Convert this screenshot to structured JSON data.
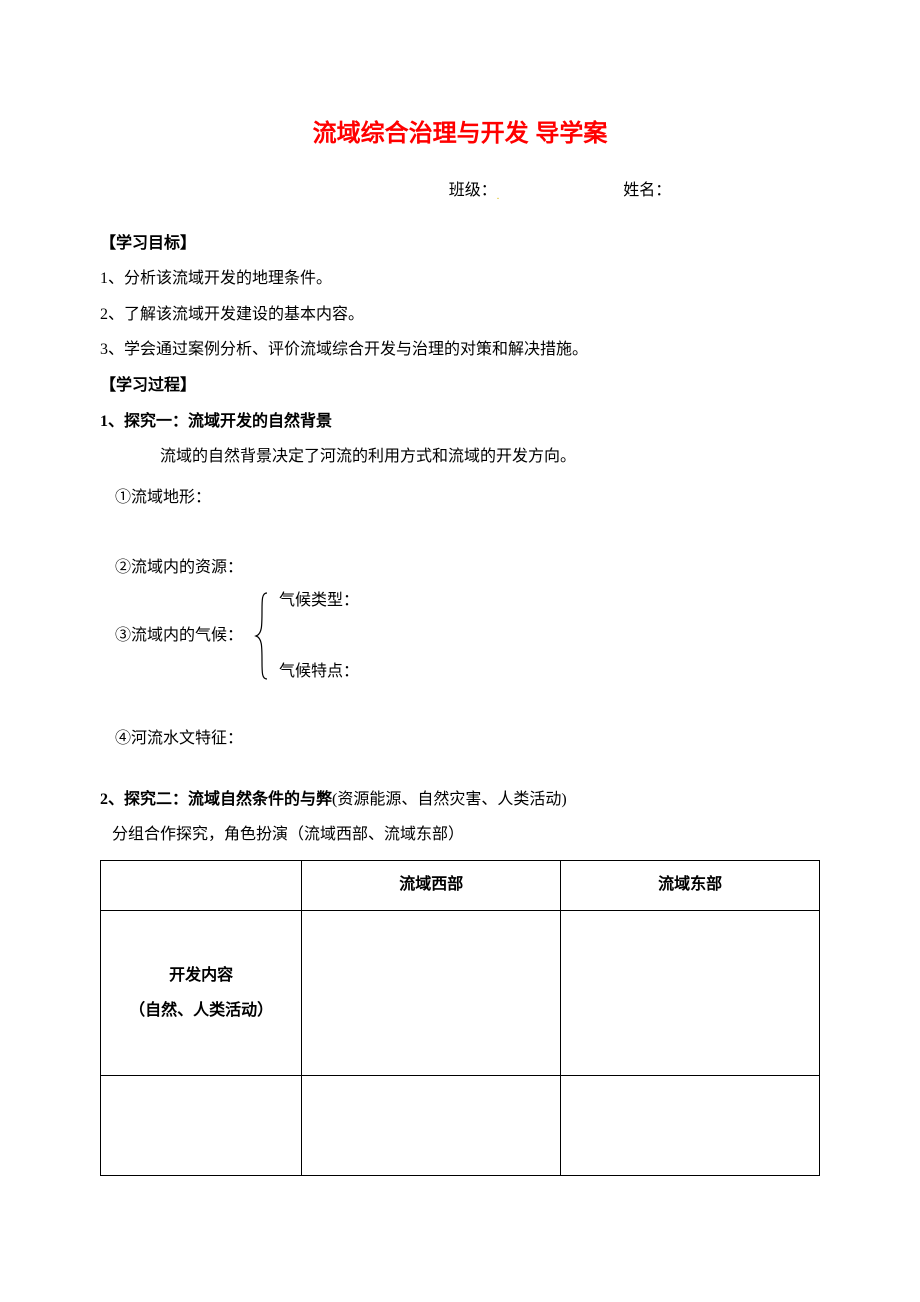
{
  "title": "流域综合治理与开发 导学案",
  "info": {
    "class_label": "班级：",
    "name_label": "姓名："
  },
  "goals_header": "【学习目标】",
  "goals": [
    "1、分析该流域开发的地理条件。",
    "2、了解该流域开发建设的基本内容。",
    "3、学会通过案例分析、评价流域综合开发与治理的对策和解决措施。"
  ],
  "process_header": "【学习过程】",
  "inquiry1": {
    "header": "1、探究一：流域开发的自然背景",
    "intro": "流域的自然背景决定了河流的利用方式和流域的开发方向。",
    "item1": "①流域地形：",
    "item2": "②流域内的资源：",
    "item3_label": "③流域内的气候：",
    "climate_a": "气候类型：",
    "climate_b": "气候特点：",
    "item4": "④河流水文特征："
  },
  "inquiry2": {
    "header_bold": "2、探究二：流域自然条件的与弊",
    "header_paren": "(资源能源、自然灾害、人类活动)",
    "sub": "分组合作探究，角色扮演（流域西部、流域东部）"
  },
  "table": {
    "col2_header": "流域西部",
    "col3_header": "流域东部",
    "row1_line1": "开发内容",
    "row1_line2": "（自然、人类活动）"
  }
}
